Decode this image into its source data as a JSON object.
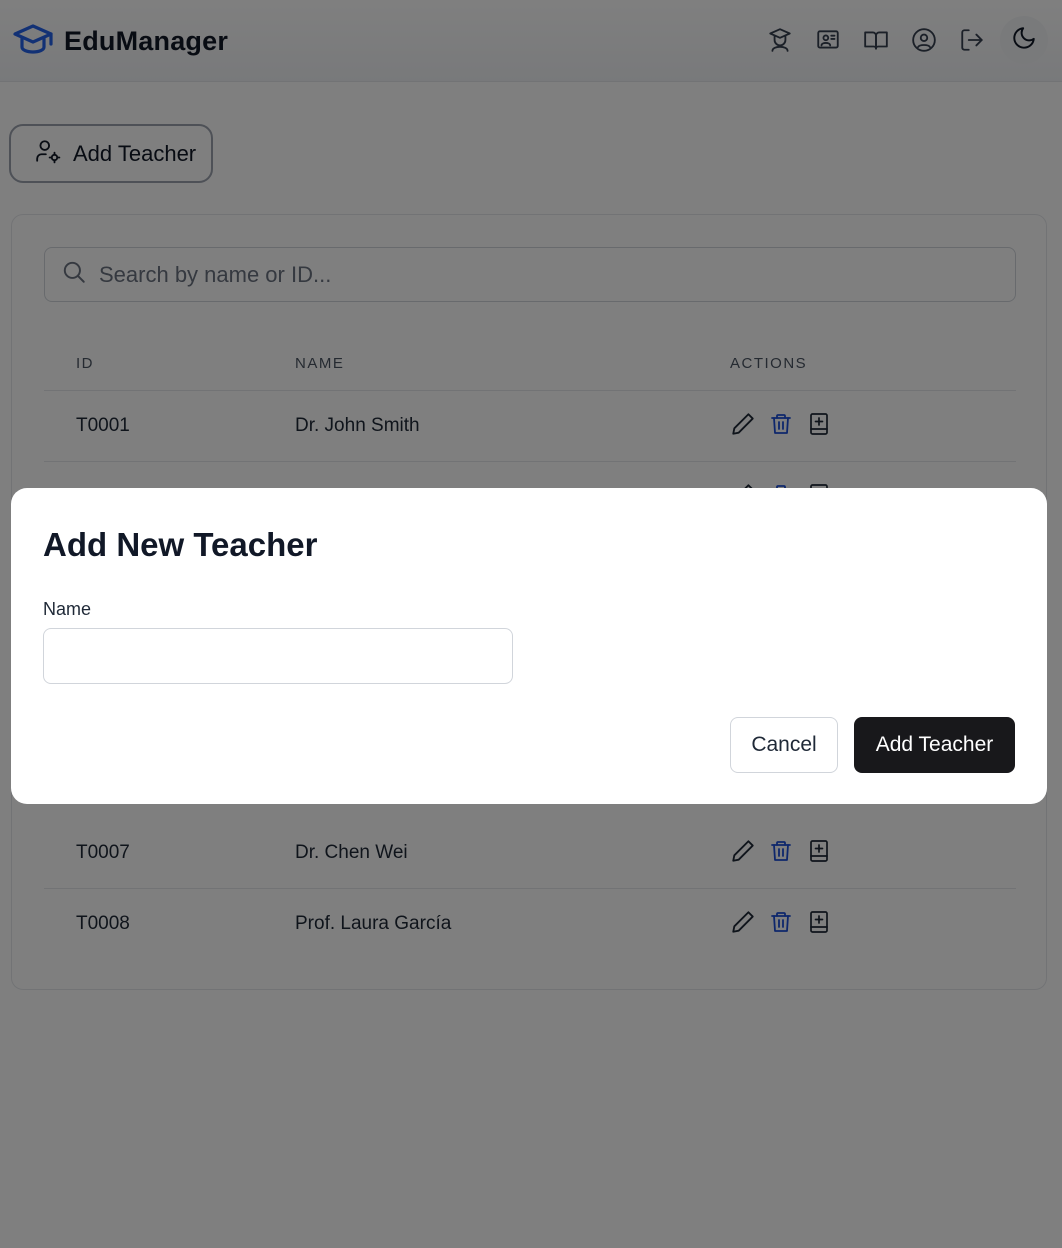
{
  "app": {
    "title": "EduManager",
    "brand_color": "#2563eb"
  },
  "header": {
    "nav_icons": [
      "teacher-icon",
      "classroom-icon",
      "book-icon",
      "user-circle-icon",
      "logout-icon"
    ],
    "theme_icon": "moon-icon"
  },
  "main": {
    "add_button_label": "Add Teacher",
    "search": {
      "placeholder": "Search by name or ID...",
      "value": ""
    },
    "table": {
      "columns": [
        "ID",
        "NAME",
        "ACTIONS"
      ],
      "rows": [
        {
          "id": "T0001",
          "name": "Dr. John Smith"
        },
        {
          "id": "T0007",
          "name": "Dr. Chen Wei"
        },
        {
          "id": "T0008",
          "name": "Prof. Laura García"
        }
      ],
      "action_icons": [
        "edit-icon",
        "delete-icon",
        "assign-course-icon"
      ],
      "delete_color": "#1d4ed8"
    }
  },
  "modal": {
    "title": "Add New Teacher",
    "name_label": "Name",
    "name_value": "",
    "cancel_label": "Cancel",
    "submit_label": "Add Teacher"
  }
}
